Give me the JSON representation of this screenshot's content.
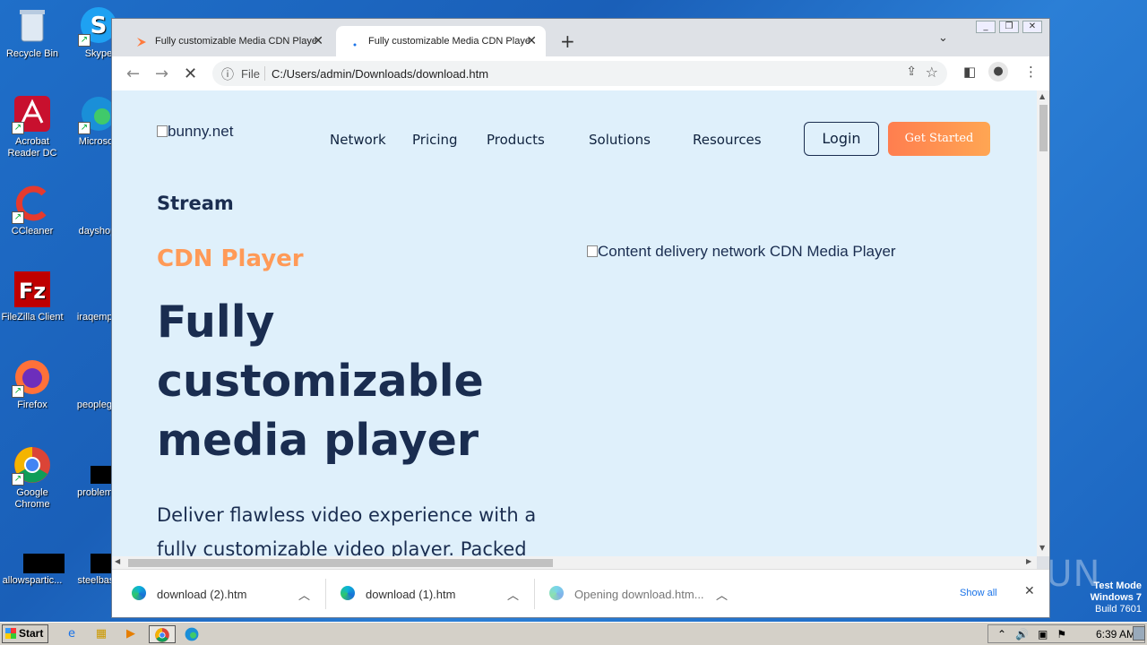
{
  "desktop": {
    "icons": [
      {
        "label": "Recycle Bin"
      },
      {
        "label": "Skype"
      },
      {
        "label": "Acrobat Reader DC"
      },
      {
        "label": "Microsoft"
      },
      {
        "label": "CCleaner"
      },
      {
        "label": "dayshop."
      },
      {
        "label": "FileZilla Client"
      },
      {
        "label": "iraqemplo"
      },
      {
        "label": "Firefox"
      },
      {
        "label": "peopleget"
      },
      {
        "label": "Google Chrome"
      },
      {
        "label": "problemsl"
      },
      {
        "label": "allowspartic..."
      },
      {
        "label": "steelbase"
      }
    ]
  },
  "browser": {
    "tabs": [
      {
        "title": "Fully customizable Media CDN Player",
        "active": false
      },
      {
        "title": "Fully customizable Media CDN Player",
        "active": true
      }
    ],
    "address": {
      "scheme_label": "File",
      "url": "C:/Users/admin/Downloads/download.htm"
    }
  },
  "page": {
    "logo_alt": "bunny.net",
    "nav": [
      "Network",
      "Pricing",
      "Products",
      "Solutions",
      "Resources"
    ],
    "login_label": "Login",
    "get_started_label": "Get Started",
    "eyebrow": "Stream",
    "subtitle": "CDN Player",
    "headline": "Fully customizable media player",
    "lead": "Deliver flawless video experience with a fully customizable video player. Packed",
    "hero_image_alt": "Content delivery network CDN Media Player"
  },
  "downloads": {
    "items": [
      {
        "name": "download (2).htm"
      },
      {
        "name": "download (1).htm"
      },
      {
        "name": "Opening download.htm..."
      }
    ],
    "show_all_label": "Show all"
  },
  "watermark": "ANY RUN",
  "os": {
    "line1": "Test Mode",
    "line2": "Windows 7",
    "line3": "Build 7601"
  },
  "taskbar": {
    "start_label": "Start",
    "clock": "6:39 AM"
  }
}
